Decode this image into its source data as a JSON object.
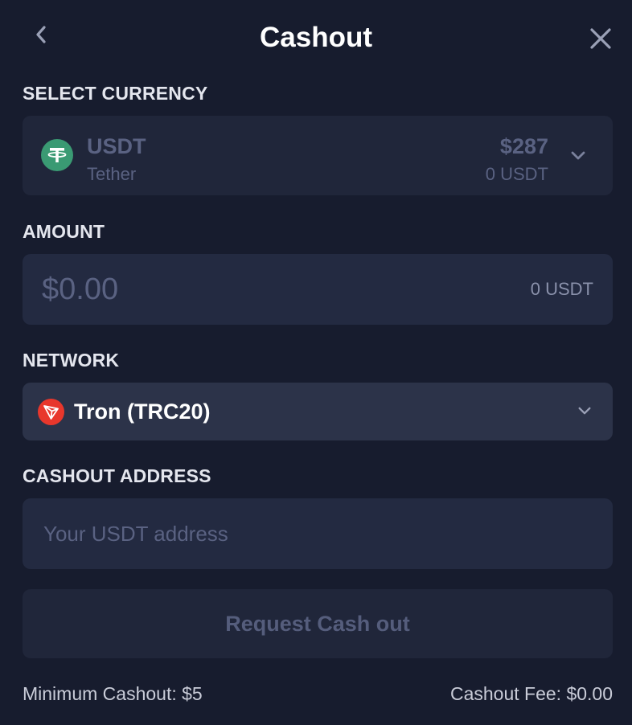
{
  "header": {
    "title": "Cashout",
    "back_icon": "chevron-left-icon",
    "close_icon": "close-icon"
  },
  "currency": {
    "section_label": "SELECT CURRENCY",
    "symbol": "USDT",
    "name": "Tether",
    "usd_value": "$287",
    "balance": "0 USDT",
    "icon": "tether-icon",
    "icon_color": "#3a9a73"
  },
  "amount": {
    "section_label": "AMOUNT",
    "placeholder": "$0.00",
    "unit_value": "0 USDT"
  },
  "network": {
    "section_label": "NETWORK",
    "selected": "Tron (TRC20)",
    "icon": "tron-icon",
    "icon_color": "#e8372c"
  },
  "address": {
    "section_label": "CASHOUT ADDRESS",
    "placeholder": "Your USDT address"
  },
  "actions": {
    "request_label": "Request Cash out"
  },
  "footer": {
    "minimum": "Minimum Cashout: $5",
    "fee": "Cashout Fee: $0.00"
  },
  "colors": {
    "background": "#171c2e",
    "field": "#232a41",
    "muted_text": "#5a6282"
  }
}
